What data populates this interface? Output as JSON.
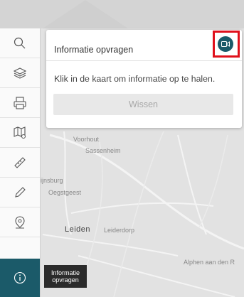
{
  "sidebar": {
    "tools": [
      {
        "icon": "search-icon"
      },
      {
        "icon": "layers-icon"
      },
      {
        "icon": "print-icon"
      },
      {
        "icon": "map-settings-icon"
      },
      {
        "icon": "ruler-icon"
      },
      {
        "icon": "pencil-icon"
      },
      {
        "icon": "location-pin-icon"
      },
      {
        "icon": "info-icon"
      }
    ],
    "active_tooltip": {
      "line1": "Informatie",
      "line2": "opvragen"
    }
  },
  "panel": {
    "title": "Informatie opvragen",
    "text": "Klik in de kaart om informatie op te halen.",
    "button_label": "Wissen",
    "video_icon": "video-camera-icon"
  },
  "map": {
    "places": [
      "Voorhout",
      "Sassenheim",
      "ijnsburg",
      "Oegstgeest",
      "Leiden",
      "Leiderdorp",
      "Alphen aan den R"
    ]
  },
  "colors": {
    "accent": "#1b5a69",
    "highlight": "#e0101b"
  }
}
